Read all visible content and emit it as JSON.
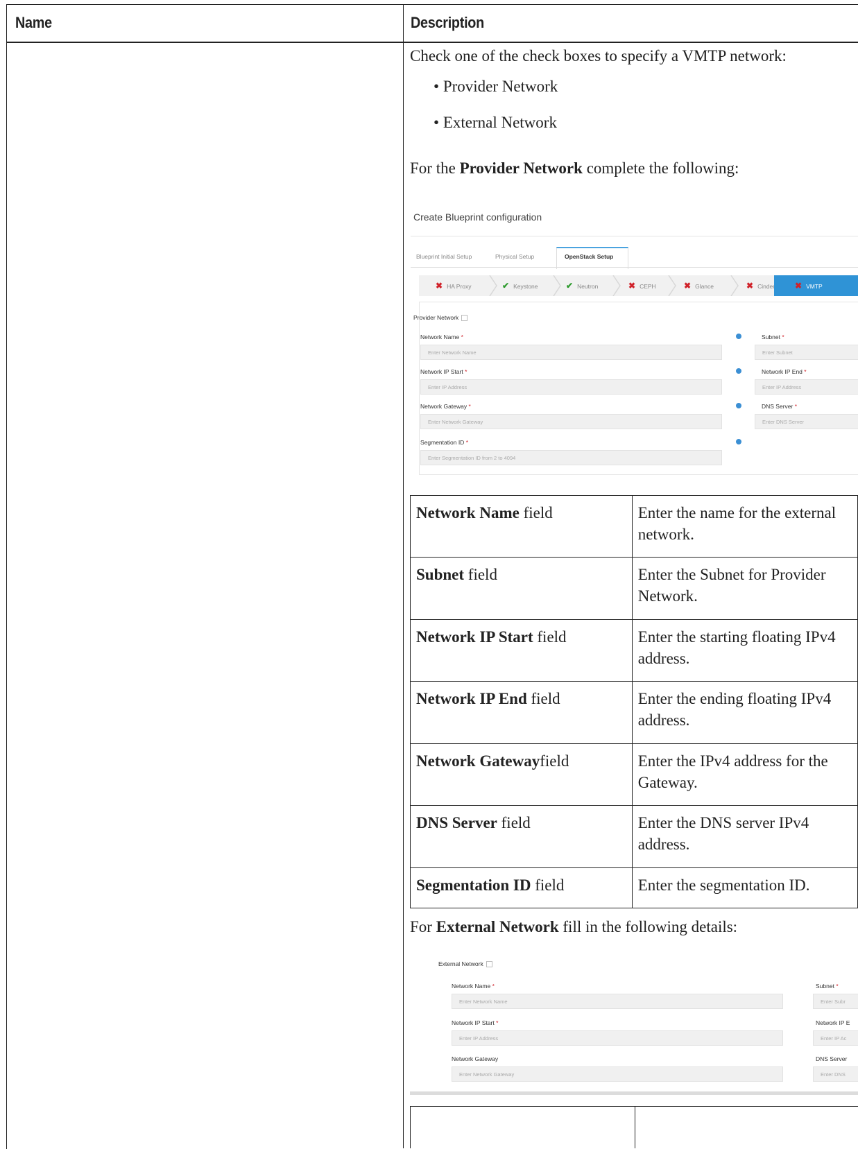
{
  "table": {
    "header_name": "Name",
    "header_description": "Description"
  },
  "intro": "Check one of the check boxes to specify a VMTP network:",
  "bullets": [
    "Provider Network",
    "External Network"
  ],
  "provider_intro": {
    "prefix": "For the ",
    "bold": "Provider Network",
    "suffix": " complete the following:"
  },
  "screenshot1": {
    "title": "Create Blueprint configuration",
    "tabs": [
      "Blueprint Initial Setup",
      "Physical Setup",
      "OpenStack Setup"
    ],
    "active_tab": "OpenStack Setup",
    "steps": [
      {
        "label": "HA Proxy",
        "status": "error"
      },
      {
        "label": "Keystone",
        "status": "ok"
      },
      {
        "label": "Neutron",
        "status": "ok"
      },
      {
        "label": "CEPH",
        "status": "error"
      },
      {
        "label": "Glance",
        "status": "error"
      },
      {
        "label": "Cinder",
        "status": "error"
      },
      {
        "label": "VMTP",
        "status": "active-error"
      }
    ],
    "section_label": "Provider Network",
    "fields": {
      "network_name_label": "Network Name",
      "network_name_placeholder": "Enter Network Name",
      "subnet_label": "Subnet",
      "subnet_placeholder": "Enter Subnet",
      "ip_start_label": "Network IP Start",
      "ip_start_placeholder": "Enter IP Address",
      "ip_end_label": "Network IP End",
      "ip_end_placeholder": "Enter IP Address",
      "gateway_label": "Network Gateway",
      "gateway_placeholder": "Enter Network Gateway",
      "dns_label": "DNS Server",
      "dns_placeholder": "Enter DNS Server",
      "segmentation_label": "Segmentation ID",
      "segmentation_placeholder": "Enter Segmentation ID from 2 to 4094"
    },
    "required_mark": "*"
  },
  "field_table": [
    {
      "name_bold": "Network Name",
      "name_suffix": " field",
      "description": "Enter the name for the external network."
    },
    {
      "name_bold": "Subnet",
      "name_suffix": " field",
      "description": "Enter the Subnet for Provider Network."
    },
    {
      "name_bold": "Network IP Start",
      "name_suffix": "  field",
      "description": "Enter the starting floating IPv4 address."
    },
    {
      "name_bold": "Network IP End",
      "name_suffix": "  field",
      "description": "Enter the ending floating IPv4 address."
    },
    {
      "name_bold": "Network Gateway",
      "name_suffix": "field",
      "description": "Enter the IPv4 address for the Gateway."
    },
    {
      "name_bold": "DNS Server",
      "name_suffix": " field",
      "description": "Enter the DNS server IPv4 address."
    },
    {
      "name_bold": "Segmentation ID",
      "name_suffix": "  field",
      "description": "Enter the segmentation ID."
    }
  ],
  "external_intro": {
    "prefix": "For ",
    "bold": "External Network",
    "suffix": " fill in the following details:"
  },
  "screenshot2": {
    "section_label": "External Network",
    "network_name_label": "Network Name",
    "network_name_placeholder": "Enter Network Name",
    "subnet_label": "Subnet",
    "subnet_placeholder": "Enter Subr",
    "ip_start_label": "Network IP Start",
    "ip_start_placeholder": "Enter IP Address",
    "ip_end_label": "Network IP E",
    "ip_end_placeholder": "Enter IP Ac",
    "gateway_label": "Network Gateway",
    "gateway_placeholder": "Enter Network Gateway",
    "dns_label": "DNS Server",
    "dns_placeholder": "Enter DNS"
  },
  "colors": {
    "error": "#d0222a",
    "ok": "#2c9a2c",
    "active_step": "#2f93d6",
    "info_icon": "#3b8fd4"
  }
}
